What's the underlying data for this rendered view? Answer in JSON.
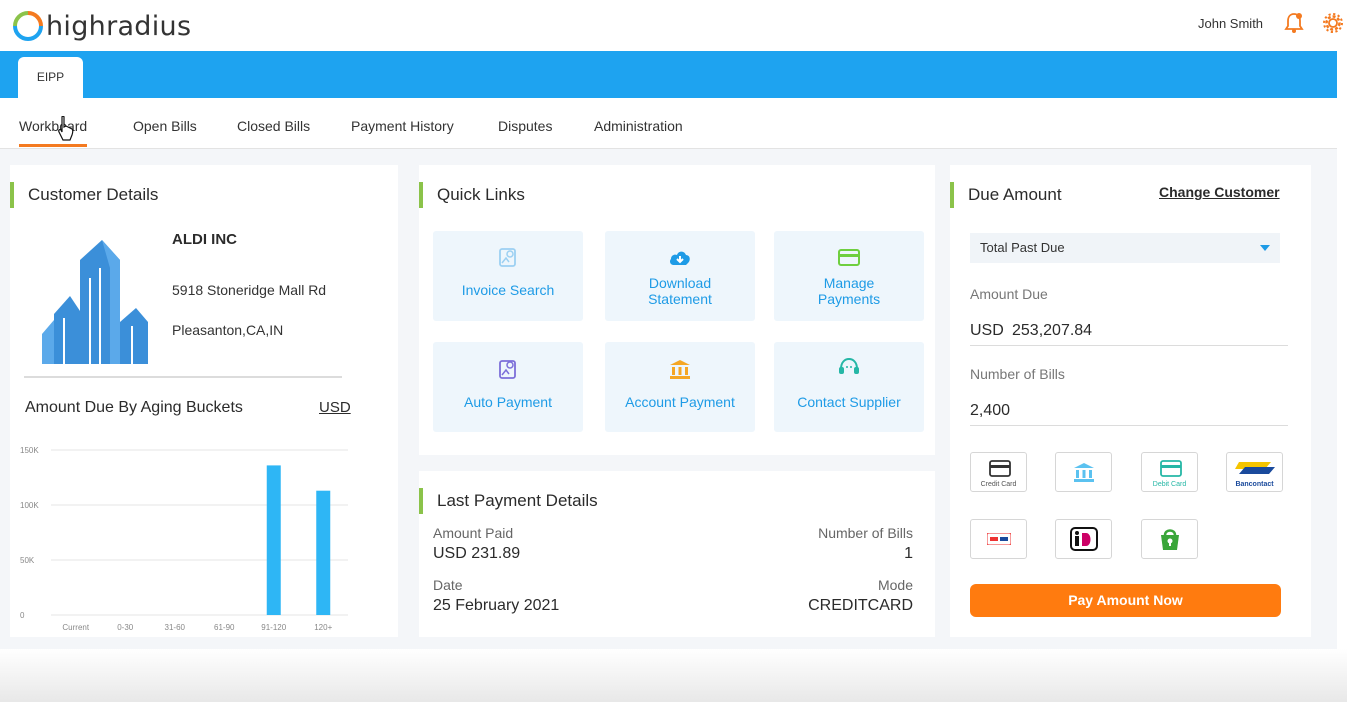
{
  "brand": {
    "name": "highradius",
    "accent": "#1ea3f0",
    "orange": "#ff7b0f",
    "green": "#8bc34a"
  },
  "header": {
    "user_name": "John Smith",
    "app_tab": "EIPP"
  },
  "nav": {
    "tabs": [
      "Workboard",
      "Open Bills",
      "Closed Bills",
      "Payment History",
      "Disputes",
      "Administration"
    ],
    "active": "Workboard"
  },
  "customer": {
    "title": "Customer Details",
    "name": "ALDI INC",
    "address": "5918 Stoneridge Mall Rd",
    "city": "Pleasanton,CA,IN"
  },
  "aging": {
    "title": "Amount Due By Aging Buckets",
    "currency": "USD"
  },
  "chart_data": {
    "type": "bar",
    "categories": [
      "Current",
      "0-30",
      "31-60",
      "61-90",
      "91-120",
      "120+"
    ],
    "values": [
      0,
      0,
      0,
      0,
      136000,
      113000
    ],
    "ylim": [
      0,
      150000
    ],
    "yticks": [
      "0",
      "50K",
      "100K",
      "150K"
    ],
    "ytick_values": [
      0,
      50000,
      100000,
      150000
    ],
    "grid": true,
    "color": "#2eb6f5"
  },
  "quick_links": {
    "title": "Quick Links",
    "items": [
      {
        "label_lines": [
          "Invoice Search"
        ],
        "icon": "image-search-icon"
      },
      {
        "label_lines": [
          "Download",
          "Statement"
        ],
        "icon": "cloud-download-icon"
      },
      {
        "label_lines": [
          "Manage",
          "Payments"
        ],
        "icon": "card-icon"
      },
      {
        "label_lines": [
          "Auto Payment"
        ],
        "icon": "auto-payment-icon"
      },
      {
        "label_lines": [
          "Account Payment"
        ],
        "icon": "bank-icon"
      },
      {
        "label_lines": [
          "Contact Supplier"
        ],
        "icon": "headset-icon"
      }
    ]
  },
  "last_payment": {
    "title": "Last Payment Details",
    "amount_paid_label": "Amount Paid",
    "amount_paid": "USD 231.89",
    "bills_label": "Number of Bills",
    "bills": "1",
    "date_label": "Date",
    "date": "25 February 2021",
    "mode_label": "Mode",
    "mode": "CREDITCARD"
  },
  "due": {
    "title": "Due Amount",
    "change_customer": "Change Customer",
    "selected_filter": "Total Past Due",
    "amount_due_label": "Amount Due",
    "currency": "USD",
    "amount_due": "253,207.84",
    "bills_label": "Number of Bills",
    "bills": "2,400",
    "payment_methods": [
      {
        "name": "Credit Card",
        "icon": "credit-card-icon"
      },
      {
        "name": "",
        "icon": "bank-icon"
      },
      {
        "name": "Debit Card",
        "icon": "debit-card-icon"
      },
      {
        "name": "Bancontact",
        "icon": "bancontact-icon"
      },
      {
        "name": "",
        "icon": "paypal-icon"
      },
      {
        "name": "",
        "icon": "ideal-icon"
      },
      {
        "name": "",
        "icon": "shopping-bag-icon"
      }
    ],
    "pay_button": "Pay Amount Now"
  }
}
